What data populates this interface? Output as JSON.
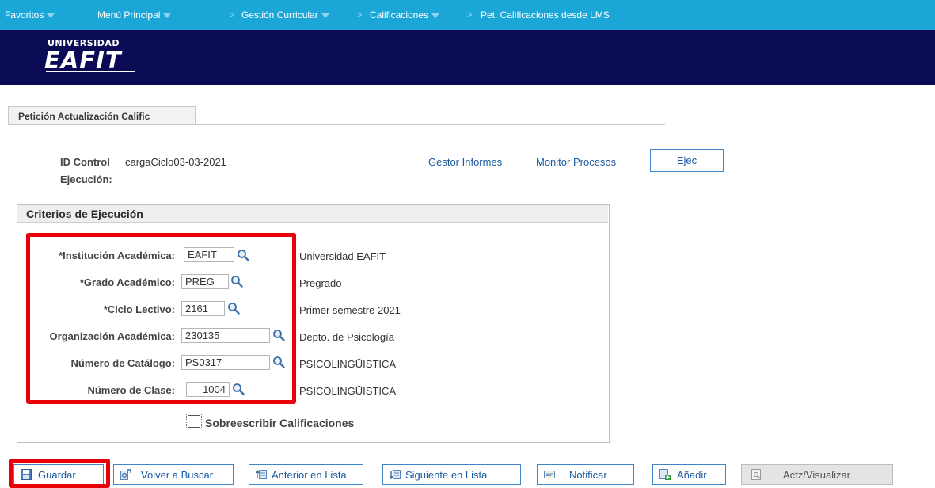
{
  "nav": {
    "favoritos": "Favoritos",
    "menu": "Menú Principal",
    "gestion": "Gestión Curricular",
    "calificaciones": "Calificaciones",
    "current": "Pet. Calificaciones desde LMS",
    "separator": ">"
  },
  "banner": {
    "logo_top": "UNIVERSIDAD",
    "logo_main": "EAFIT"
  },
  "tab": {
    "label": "Petición Actualización Calific"
  },
  "run": {
    "id_label_1": "ID Control",
    "id_label_2": "Ejecución:",
    "id_value": "cargaCiclo03-03-2021",
    "gestor": "Gestor Informes",
    "monitor": "Monitor Procesos",
    "ejec": "Ejec"
  },
  "criteria": {
    "title": "Criterios de Ejecución",
    "fields": [
      {
        "label": "*Institución Académica:",
        "value": "EAFIT",
        "desc": "Universidad EAFIT"
      },
      {
        "label": "*Grado Académico:",
        "value": "PREG",
        "desc": "Pregrado"
      },
      {
        "label": "*Ciclo Lectivo:",
        "value": "2161",
        "desc": "Primer semestre 2021"
      },
      {
        "label": "Organización Académica:",
        "value": "230135",
        "desc": "Depto. de Psicología"
      },
      {
        "label": "Número de Catálogo:",
        "value": "PS0317",
        "desc": "PSICOLINGÜISTICA"
      },
      {
        "label": "Número de Clase:",
        "value": "1004",
        "desc": "PSICOLINGÜISTICA"
      }
    ],
    "overwrite": "Sobreescribir Calificaciones",
    "overwrite_checked": false
  },
  "buttons": {
    "guardar": "Guardar",
    "volver": "Volver a Buscar",
    "anterior": "Anterior en Lista",
    "siguiente": "Siguiente en Lista",
    "notificar": "Notificar",
    "anadir": "Añadir",
    "actz": "Actz/Visualizar"
  },
  "icons": {
    "lookup": "magnifier-icon",
    "save": "floppy-disk-icon",
    "return": "return-to-search-icon",
    "previous": "previous-in-list-icon",
    "next": "next-in-list-icon",
    "notify": "notify-icon",
    "add": "add-icon",
    "update": "update-display-icon"
  },
  "colors": {
    "nav_bg": "#1aa7d8",
    "banner_bg": "#0b0b55",
    "highlight": "#e8000b",
    "link": "#1b5aa0"
  }
}
